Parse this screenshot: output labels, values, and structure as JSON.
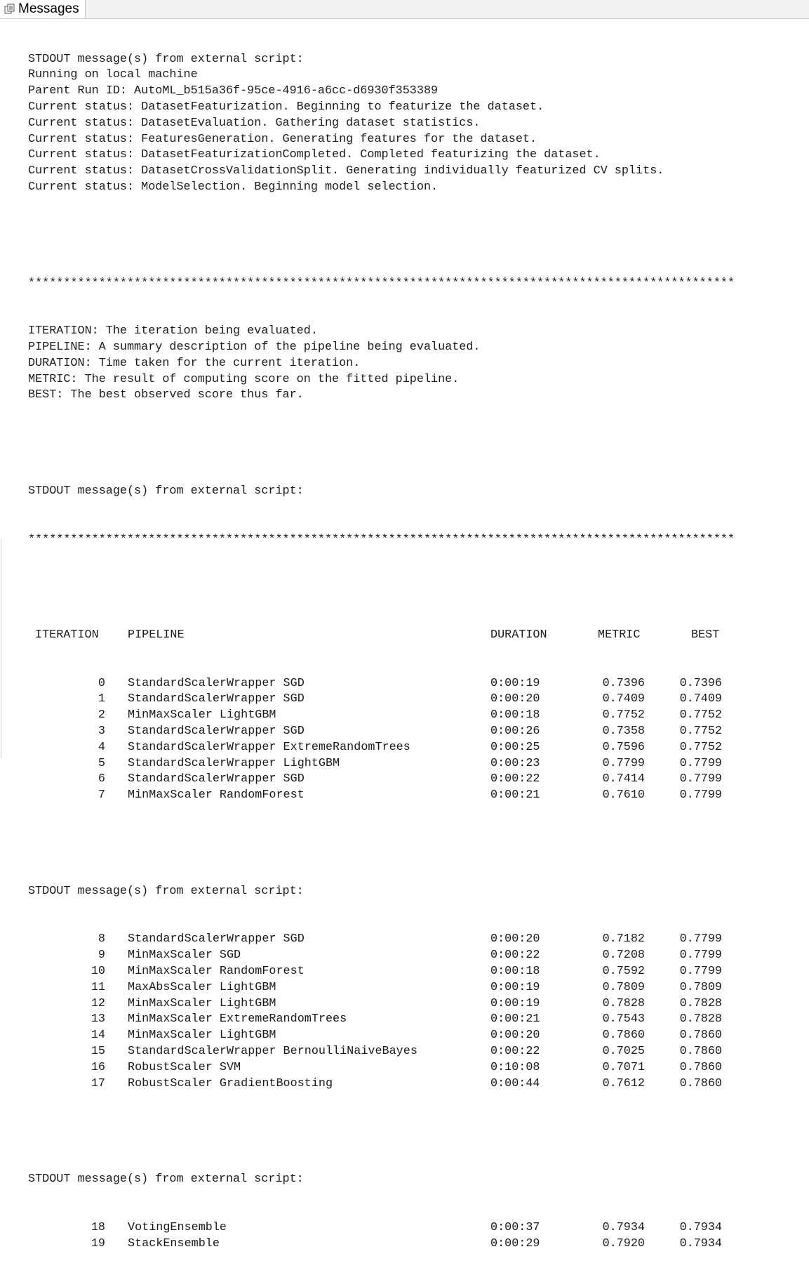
{
  "tab": {
    "label": "Messages",
    "icon": "messages-icon"
  },
  "block1": [
    "STDOUT message(s) from external script:",
    "Running on local machine",
    "Parent Run ID: AutoML_b515a36f-95ce-4916-a6cc-d6930f353389",
    "Current status: DatasetFeaturization. Beginning to featurize the dataset.",
    "Current status: DatasetEvaluation. Gathering dataset statistics.",
    "Current status: FeaturesGeneration. Generating features for the dataset.",
    "Current status: DatasetFeaturizationCompleted. Completed featurizing the dataset.",
    "Current status: DatasetCrossValidationSplit. Generating individually featurized CV splits.",
    "Current status: ModelSelection. Beginning model selection."
  ],
  "separator": "****************************************************************************************************",
  "legend": [
    "ITERATION: The iteration being evaluated.",
    "PIPELINE: A summary description of the pipeline being evaluated.",
    "DURATION: Time taken for the current iteration.",
    "METRIC: The result of computing score on the fitted pipeline.",
    "BEST: The best observed score thus far."
  ],
  "stdout_header": "STDOUT message(s) from external script:",
  "columns": {
    "iteration": "ITERATION",
    "pipeline": "PIPELINE",
    "duration": "DURATION",
    "metric": "METRIC",
    "best": "BEST"
  },
  "group1": [
    {
      "iter": "0",
      "pipeline": "StandardScalerWrapper SGD",
      "duration": "0:00:19",
      "metric": "0.7396",
      "best": "0.7396"
    },
    {
      "iter": "1",
      "pipeline": "StandardScalerWrapper SGD",
      "duration": "0:00:20",
      "metric": "0.7409",
      "best": "0.7409"
    },
    {
      "iter": "2",
      "pipeline": "MinMaxScaler LightGBM",
      "duration": "0:00:18",
      "metric": "0.7752",
      "best": "0.7752"
    },
    {
      "iter": "3",
      "pipeline": "StandardScalerWrapper SGD",
      "duration": "0:00:26",
      "metric": "0.7358",
      "best": "0.7752"
    },
    {
      "iter": "4",
      "pipeline": "StandardScalerWrapper ExtremeRandomTrees",
      "duration": "0:00:25",
      "metric": "0.7596",
      "best": "0.7752"
    },
    {
      "iter": "5",
      "pipeline": "StandardScalerWrapper LightGBM",
      "duration": "0:00:23",
      "metric": "0.7799",
      "best": "0.7799"
    },
    {
      "iter": "6",
      "pipeline": "StandardScalerWrapper SGD",
      "duration": "0:00:22",
      "metric": "0.7414",
      "best": "0.7799"
    },
    {
      "iter": "7",
      "pipeline": "MinMaxScaler RandomForest",
      "duration": "0:00:21",
      "metric": "0.7610",
      "best": "0.7799"
    }
  ],
  "group2": [
    {
      "iter": "8",
      "pipeline": "StandardScalerWrapper SGD",
      "duration": "0:00:20",
      "metric": "0.7182",
      "best": "0.7799"
    },
    {
      "iter": "9",
      "pipeline": "MinMaxScaler SGD",
      "duration": "0:00:22",
      "metric": "0.7208",
      "best": "0.7799"
    },
    {
      "iter": "10",
      "pipeline": "MinMaxScaler RandomForest",
      "duration": "0:00:18",
      "metric": "0.7592",
      "best": "0.7799"
    },
    {
      "iter": "11",
      "pipeline": "MaxAbsScaler LightGBM",
      "duration": "0:00:19",
      "metric": "0.7809",
      "best": "0.7809"
    },
    {
      "iter": "12",
      "pipeline": "MinMaxScaler LightGBM",
      "duration": "0:00:19",
      "metric": "0.7828",
      "best": "0.7828"
    },
    {
      "iter": "13",
      "pipeline": "MinMaxScaler ExtremeRandomTrees",
      "duration": "0:00:21",
      "metric": "0.7543",
      "best": "0.7828"
    },
    {
      "iter": "14",
      "pipeline": "MinMaxScaler LightGBM",
      "duration": "0:00:20",
      "metric": "0.7860",
      "best": "0.7860"
    },
    {
      "iter": "15",
      "pipeline": "StandardScalerWrapper BernoulliNaiveBayes",
      "duration": "0:00:22",
      "metric": "0.7025",
      "best": "0.7860"
    },
    {
      "iter": "16",
      "pipeline": "RobustScaler SVM",
      "duration": "0:10:08",
      "metric": "0.7071",
      "best": "0.7860"
    },
    {
      "iter": "17",
      "pipeline": "RobustScaler GradientBoosting",
      "duration": "0:00:44",
      "metric": "0.7612",
      "best": "0.7860"
    }
  ],
  "group3": [
    {
      "iter": "18",
      "pipeline": "VotingEnsemble",
      "duration": "0:00:37",
      "metric": "0.7934",
      "best": "0.7934"
    },
    {
      "iter": "19",
      "pipeline": "StackEnsemble",
      "duration": "0:00:29",
      "metric": "0.7920",
      "best": "0.7934"
    }
  ]
}
